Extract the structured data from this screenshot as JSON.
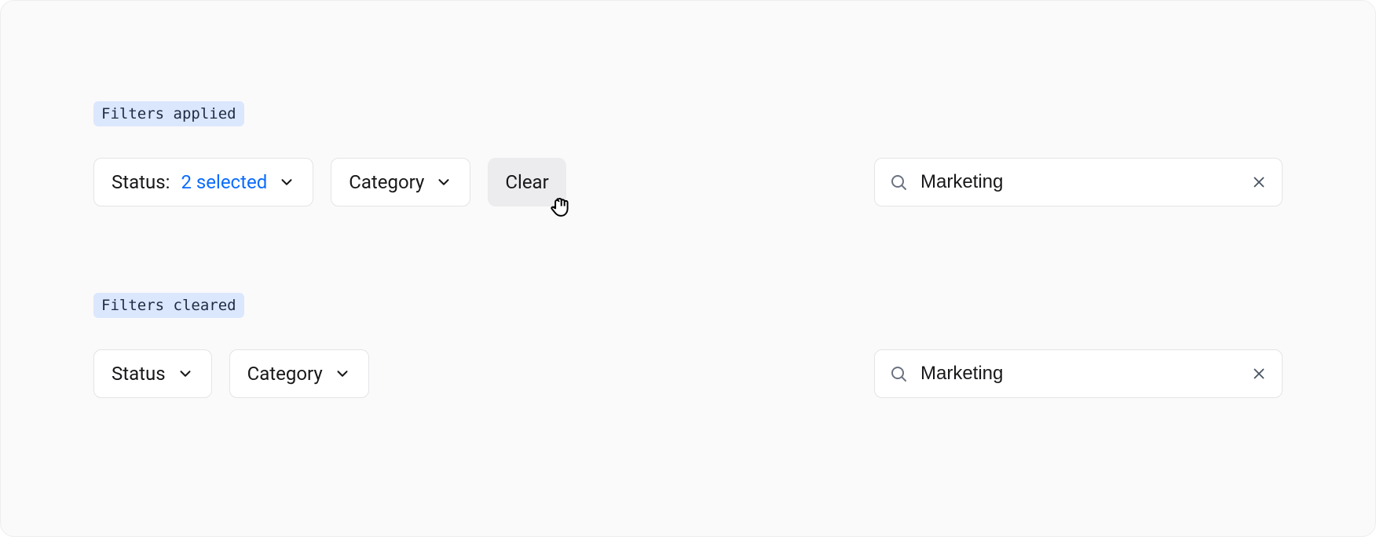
{
  "applied": {
    "tag": "Filters applied",
    "status_label": "Status:",
    "status_selected": "2 selected",
    "category_label": "Category",
    "clear_label": "Clear",
    "search_value": "Marketing"
  },
  "cleared": {
    "tag": "Filters cleared",
    "status_label": "Status",
    "category_label": "Category",
    "search_value": "Marketing"
  }
}
